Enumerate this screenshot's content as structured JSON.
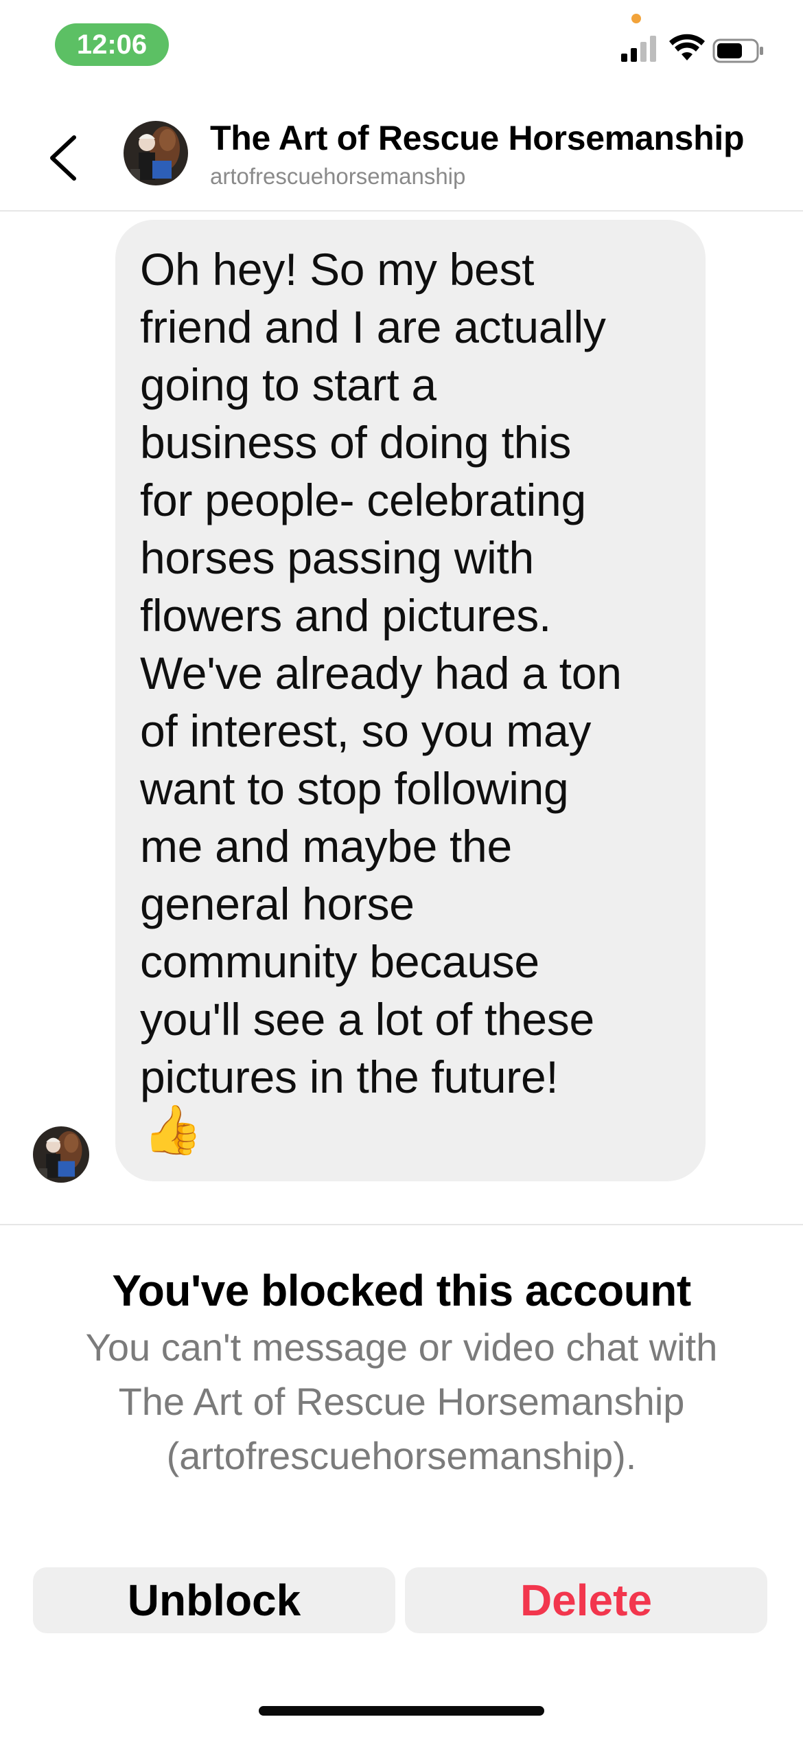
{
  "status_bar": {
    "time": "12:06"
  },
  "header": {
    "title": "The Art of Rescue Horsemanship",
    "username": "artofrescuehorsemanship"
  },
  "message": {
    "text": "Oh hey! So my best\nfriend and I are actually\ngoing to start a\nbusiness of doing this\nfor people- celebrating\nhorses passing with\nflowers and pictures.\nWe've already had a ton\nof interest, so you may\nwant to stop following\nme and maybe the\ngeneral horse\ncommunity because\nyou'll see a lot of these\npictures in the future!",
    "emoji": "👍",
    "bubble_color": "#efefef"
  },
  "blocked": {
    "title": "You've blocked this account",
    "description": "You can't message or video chat with The Art of Rescue Horsemanship (artofrescuehorsemanship).",
    "unblock_label": "Unblock",
    "delete_label": "Delete",
    "delete_color": "#f2364d"
  },
  "colors": {
    "time_pill": "#5cc064",
    "privacy_dot": "#f2a33a",
    "secondary_text": "#7b7b7b"
  }
}
